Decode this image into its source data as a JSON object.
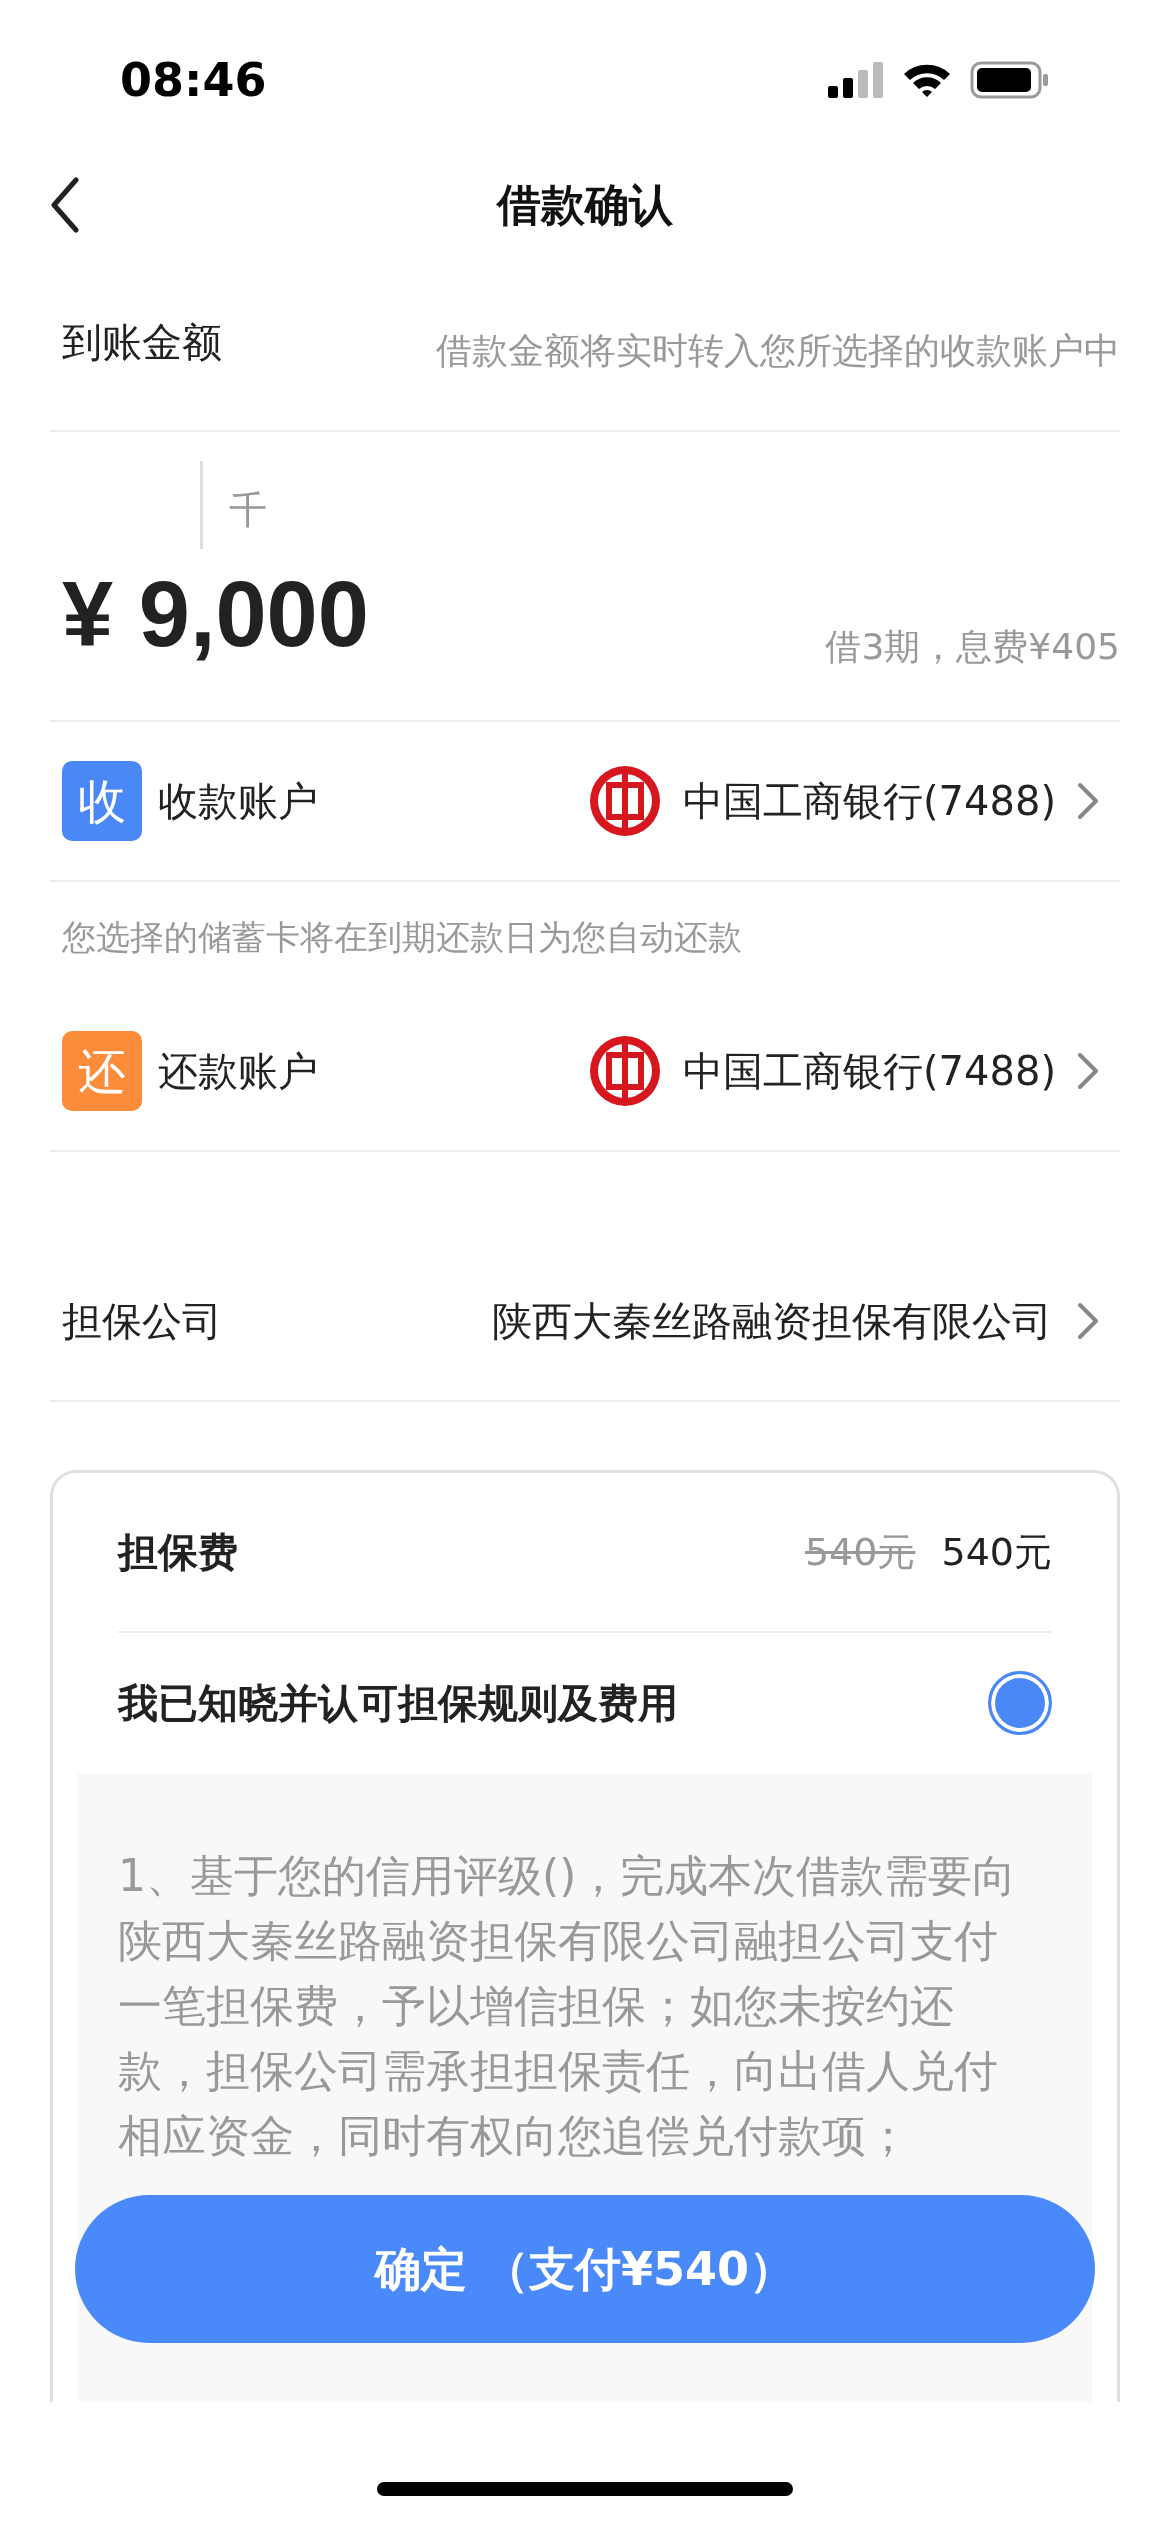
{
  "status_bar": {
    "time": "08:46"
  },
  "nav": {
    "title": "借款确认"
  },
  "amount_section": {
    "label": "到账金额",
    "hint": "借款金额将实时转入您所选择的收款账户中",
    "unit_hint": "千",
    "amount": "¥ 9,000",
    "terms": "借3期，息费¥405"
  },
  "accounts": [
    {
      "badge": "收",
      "color": "#4b88f7",
      "label": "收款账户",
      "bank": "中国工商银行(7488)",
      "note": "您选择的储蓄卡将在到期还款日为您自动还款"
    },
    {
      "badge": "还",
      "color": "#fb8c3a",
      "label": "还款账户",
      "bank": "中国工商银行(7488)"
    }
  ],
  "guarantor": {
    "label": "担保公司",
    "value": "陕西大秦丝路融资担保有限公司"
  },
  "fee_card": {
    "label": "担保费",
    "original_price": "540元",
    "price": "540元",
    "agreement": {
      "label": "我已知晓并认可担保规则及费用",
      "checked": true
    },
    "terms": [
      [
        {
          "text": "1、基于您的信用评级()，完成本次借款需要向陕西大秦丝路融资担保有限公司融担公司支付一笔担保费，予以增信担保；如您未按约还款，担保公司需承担担保责任，向出借人兑付相应资金，同时有权向您追偿兑付款项；",
          "kind": "normal"
        }
      ]
    ]
  },
  "confirm_button": {
    "label": "确定 （支付¥540）"
  }
}
